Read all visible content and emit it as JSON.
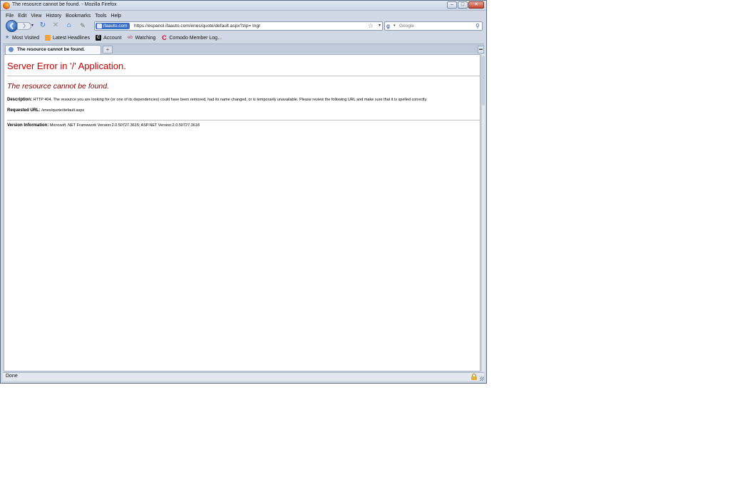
{
  "window": {
    "title": "The resource cannot be found. - Mozilla Firefox",
    "controls": {
      "minimize": "–",
      "maximize": "□",
      "close": "✕"
    }
  },
  "menu": [
    "File",
    "Edit",
    "View",
    "History",
    "Bookmarks",
    "Tools",
    "Help"
  ],
  "nav": {
    "identity_label": "ifaauto.com",
    "url": "https://espanol.ifaauto.com/enes/quote/default.aspx?zip= Ingr",
    "search_placeholder": "Google",
    "icons": {
      "back": "back-arrow-icon",
      "forward": "forward-arrow-icon",
      "reload": "reload-icon",
      "stop": "stop-icon",
      "home": "home-icon",
      "tools": "tools-icon",
      "bookmark_star": "star-icon",
      "search": "magnifier-icon"
    }
  },
  "bookmarks": [
    "Most Visited",
    "Latest Headlines",
    "Account",
    "Watching",
    "Comodo Member Log..."
  ],
  "tabs": [
    {
      "label": "The resource cannot be found.",
      "active": true
    }
  ],
  "page": {
    "heading": "Server Error in '/' Application.",
    "subheading": "The resource cannot be found.",
    "description_label": "Description:",
    "description_text": "HTTP 404. The resource you are looking for (or one of its dependencies) could have been removed, had its name changed, or is temporarily unavailable.  Please review the following URL and make sure that it is spelled correctly.",
    "requested_url_label": "Requested URL:",
    "requested_url_value": "/enes/quote/default.aspx",
    "version_label": "Version Information:",
    "version_value": "Microsoft .NET Framework Version:2.0.50727.3615; ASP.NET Version:2.0.50727.3618"
  },
  "status": {
    "text": "Done"
  },
  "colors": {
    "heading": "#cc0000",
    "subheading": "#800000",
    "identity_bg": "#3b6fc4"
  }
}
